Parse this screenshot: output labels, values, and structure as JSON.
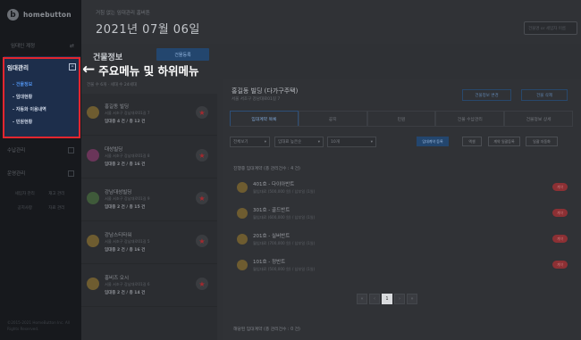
{
  "sidebar": {
    "brand": "homebutton",
    "account": "임대인 계정",
    "rent_menu": {
      "title": "임대관리",
      "items": [
        "- 건물정보",
        "- 임대현황",
        "- 자동화 이용내역",
        "- 민원현황"
      ]
    },
    "sections": [
      "수납관리",
      "운영관리"
    ],
    "grid_items": [
      "세입자 관리",
      "재고 관리",
      "공지사항",
      "자료 관리"
    ],
    "footer": "©2015-2021 HomeButton Inc. All Rights Reserved."
  },
  "header": {
    "subtitle": "거침 없는 임대관리 홈버튼",
    "date": "2021년 07월 06일",
    "search_placeholder": "건물명 or 세입자 이름"
  },
  "page": {
    "title": "건물정보",
    "register_button": "건물등록",
    "list_meta": "건물 수 6개 · 세대 수 24세대"
  },
  "buildings": [
    {
      "name": "홍길동 빌딩",
      "address": "서울 서초구 강남대로01길 7",
      "count": "임대중 4 건 / 총 12 건",
      "color": "#6e5c30"
    },
    {
      "name": "대성빌딩",
      "address": "서울 서초구 강남대로01길 8",
      "count": "임대중 2 건 / 총 16 건",
      "color": "#6a3559"
    },
    {
      "name": "강남대성빌딩",
      "address": "서울 서초구 강남대로01길 9",
      "count": "임대중 2 건 / 총 15 건",
      "color": "#3f5a3a"
    },
    {
      "name": "강남스티타워",
      "address": "서울 서초구 강남대로01길 5",
      "count": "임대중 2 건 / 총 16 건",
      "color": "#6e5c30"
    },
    {
      "name": "홍비즈 오시",
      "address": "서울 서초구 강남대로01길 6",
      "count": "임대중 2 건 / 총 14 건",
      "color": "#6e5c30"
    }
  ],
  "detail": {
    "title": "홍길동 빌딩 (다가구주택)",
    "address": "서울 서초구 강남대로01길 7",
    "edit_button": "건물정보 변경",
    "delete_button": "건물 삭제",
    "tabs": [
      "임대계약 목록",
      "공지",
      "민원",
      "건물 수납관리",
      "건물정보 상세"
    ],
    "filters": [
      "전체보기",
      "임대료 높은순",
      "10개"
    ],
    "action_buttons": [
      "임대계약 등록",
      "엑셀",
      "계약 일괄등록",
      "일괄 자동화"
    ],
    "active_section": "진행중 임대계약 (총 관리건수 : 4 건)",
    "units": [
      {
        "name": "401호 - 다이아반트",
        "info": "월임대료 (500,000 원) / 납부일 (1일)",
        "badge": "계약"
      },
      {
        "name": "301호 - 골드반트",
        "info": "월임대료 (600,000 원) / 납부일 (1일)",
        "badge": "계약"
      },
      {
        "name": "201호 - 실버반트",
        "info": "월임대료 (700,000 원) / 납부일 (1일)",
        "badge": "계약"
      },
      {
        "name": "101호 - 정반트",
        "info": "월임대료 (500,000 원) / 납부일 (1일)",
        "badge": "계약"
      }
    ],
    "pager": [
      "«",
      "‹",
      "1",
      "›",
      "»"
    ],
    "expired_section": "해당된 임대계약 (총 관리건수 : 0 건)"
  },
  "annotation": {
    "arrow": "←",
    "text": "주요메뉴 및 하위메뉴"
  },
  "colors": {
    "highlight": "#e3262f",
    "accent": "#23466e",
    "active_link": "#4f8fe8"
  }
}
